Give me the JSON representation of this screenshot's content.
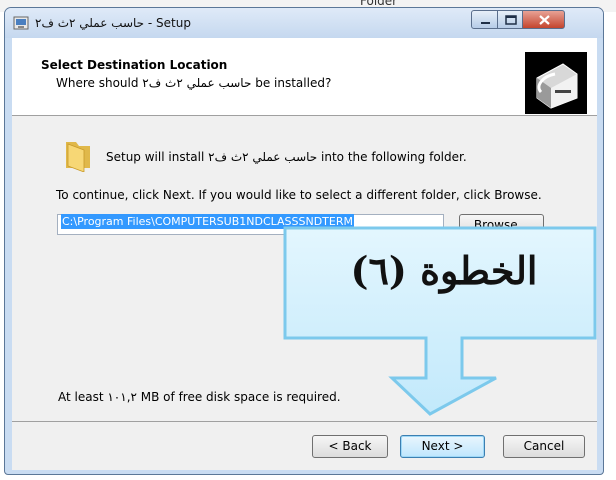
{
  "background_caption": "Folder",
  "window": {
    "title": "حاسب عملي ٢ث ف٢ - Setup",
    "buttons": [
      "minimize-icon",
      "maximize-icon",
      "close-icon"
    ]
  },
  "header": {
    "title": "Select Destination Location",
    "subtitle": "Where should حاسب عملي ٢ث ف٢ be installed?"
  },
  "body": {
    "intro": "Setup will install حاسب عملي ٢ث ف٢ into the following folder.",
    "continue": "To continue, click Next. If you would like to select a different folder, click Browse.",
    "path_value": "C:\\Program Files\\COMPUTERSUB1NDCLASSSNDTERM",
    "browse_label": "Browse...",
    "space_required": "At least ١٠١,٢ MB of free disk space is required."
  },
  "footer": {
    "back_label": "< Back",
    "next_label": "Next >",
    "cancel_label": "Cancel"
  },
  "annotation": {
    "text": "الخطوة (٦)",
    "box_color": "#cfeefd",
    "border_color": "#8fd3f3",
    "arrow_color": "#6fc8ee"
  }
}
